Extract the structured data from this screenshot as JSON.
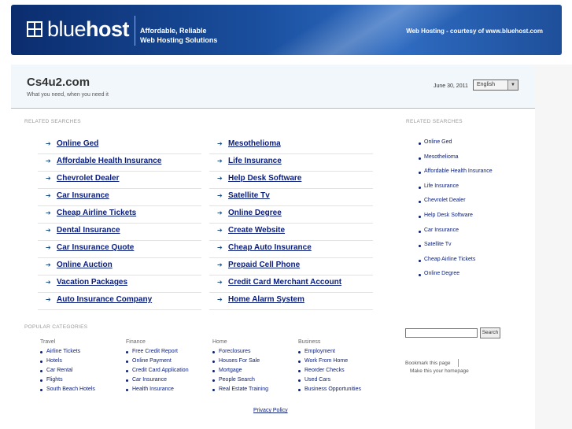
{
  "banner": {
    "logo_light": "blue",
    "logo_bold": "host",
    "tagline_line1": "Affordable, Reliable",
    "tagline_line2": "Web Hosting Solutions",
    "courtesy": "Web Hosting - courtesy of www.bluehost.com"
  },
  "header": {
    "site_title": "Cs4u2.com",
    "site_subtitle": "What you need, when you need it",
    "date": "June 30, 2011",
    "language": "English"
  },
  "related_searches_label": "RELATED SEARCHES",
  "related_left": [
    "Online Ged",
    "Affordable Health Insurance",
    "Chevrolet Dealer",
    "Car Insurance",
    "Cheap Airline Tickets",
    "Dental Insurance",
    "Car Insurance Quote",
    "Online Auction",
    "Vacation Packages",
    "Auto Insurance Company"
  ],
  "related_right": [
    "Mesothelioma",
    "Life Insurance",
    "Help Desk Software",
    "Satellite Tv",
    "Online Degree",
    "Create Website",
    "Cheap Auto Insurance",
    "Prepaid Cell Phone",
    "Credit Card Merchant Account",
    "Home Alarm System"
  ],
  "sidebar": {
    "label": "RELATED SEARCHES",
    "items": [
      "Online Ged",
      "Mesothelioma",
      "Affordable Health Insurance",
      "Life Insurance",
      "Chevrolet Dealer",
      "Help Desk Software",
      "Car Insurance",
      "Satellite Tv",
      "Cheap Airline Tickets",
      "Online Degree"
    ],
    "search_button": "Search",
    "bookmark": "Bookmark this page",
    "homepage": "Make this your homepage"
  },
  "popular": {
    "label": "POPULAR CATEGORIES",
    "columns": [
      {
        "head": "Travel",
        "items": [
          "Airline Tickets",
          "Hotels",
          "Car Rental",
          "Flights",
          "South Beach Hotels"
        ]
      },
      {
        "head": "Finance",
        "items": [
          "Free Credit Report",
          "Online Payment",
          "Credit Card Application",
          "Car Insurance",
          "Health Insurance"
        ]
      },
      {
        "head": "Home",
        "items": [
          "Foreclosures",
          "Houses For Sale",
          "Mortgage",
          "People Search",
          "Real Estate Training"
        ]
      },
      {
        "head": "Business",
        "items": [
          "Employment",
          "Work From Home",
          "Reorder Checks",
          "Used Cars",
          "Business Opportunities"
        ]
      }
    ]
  },
  "footer": {
    "privacy": "Privacy Policy"
  }
}
